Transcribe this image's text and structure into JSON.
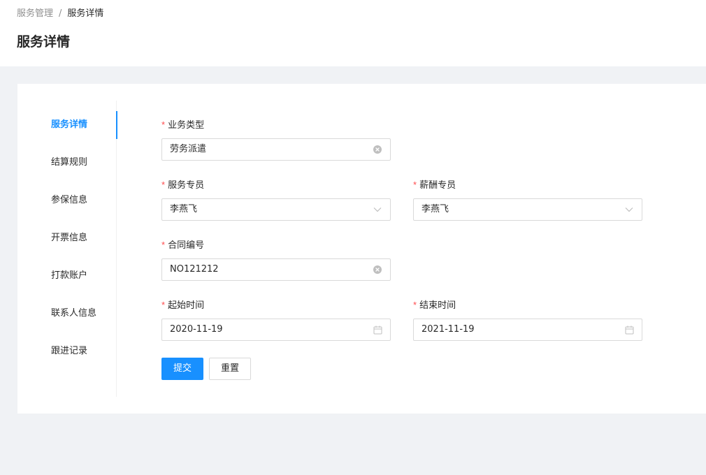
{
  "breadcrumb": {
    "parent": "服务管理",
    "separator": "/",
    "current": "服务详情"
  },
  "page_title": "服务详情",
  "nav": {
    "items": [
      {
        "label": "服务详情",
        "active": true
      },
      {
        "label": "结算规则",
        "active": false
      },
      {
        "label": "参保信息",
        "active": false
      },
      {
        "label": "开票信息",
        "active": false
      },
      {
        "label": "打款账户",
        "active": false
      },
      {
        "label": "联系人信息",
        "active": false
      },
      {
        "label": "跟进记录",
        "active": false
      }
    ]
  },
  "form": {
    "required_mark": "*",
    "business_type": {
      "label": "业务类型",
      "value": "劳务派遣"
    },
    "service_specialist": {
      "label": "服务专员",
      "value": "李燕飞"
    },
    "salary_specialist": {
      "label": "薪酬专员",
      "value": "李燕飞"
    },
    "contract_no": {
      "label": "合同编号",
      "value": "NO121212"
    },
    "start_time": {
      "label": "起始时间",
      "value": "2020-11-19"
    },
    "end_time": {
      "label": "结束时间",
      "value": "2021-11-19"
    },
    "submit_label": "提交",
    "reset_label": "重置"
  },
  "colors": {
    "primary": "#1890ff",
    "required": "#ff4d4f",
    "background": "#f0f2f5"
  }
}
